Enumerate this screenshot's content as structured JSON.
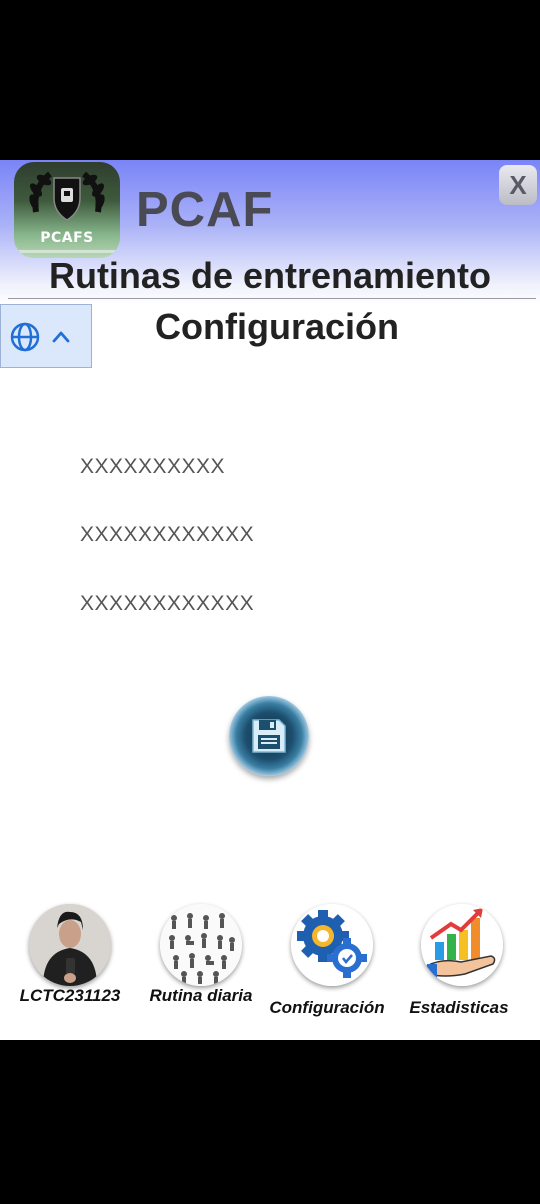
{
  "header": {
    "logo_text": "PCAFS",
    "brand": "PCAF",
    "close_label": "X",
    "subtitle": "Rutinas de entrenamiento"
  },
  "language": {
    "icon": "globe-icon",
    "toggle_icon": "chevron-up-icon"
  },
  "page": {
    "title": "Configuración"
  },
  "fields": [
    {
      "value": "XXXXXXXXXX"
    },
    {
      "value": "XXXXXXXXXXXX"
    },
    {
      "value": "XXXXXXXXXXXX"
    }
  ],
  "save_button": {
    "icon": "floppy-disk-icon"
  },
  "nav": {
    "items": [
      {
        "label": "LCTC231123",
        "icon": "user-avatar"
      },
      {
        "label": "Rutina diaria",
        "icon": "exercise-grid-icon"
      },
      {
        "label": "Configuración",
        "icon": "gears-icon"
      },
      {
        "label": "Estadisticas",
        "icon": "chart-growth-icon"
      }
    ]
  },
  "colors": {
    "header_gradient_top": "#7a84f7",
    "brand_text": "#4a4a55",
    "lang_bg": "#dbe8fb",
    "accent_blue": "#1f6fd6"
  }
}
